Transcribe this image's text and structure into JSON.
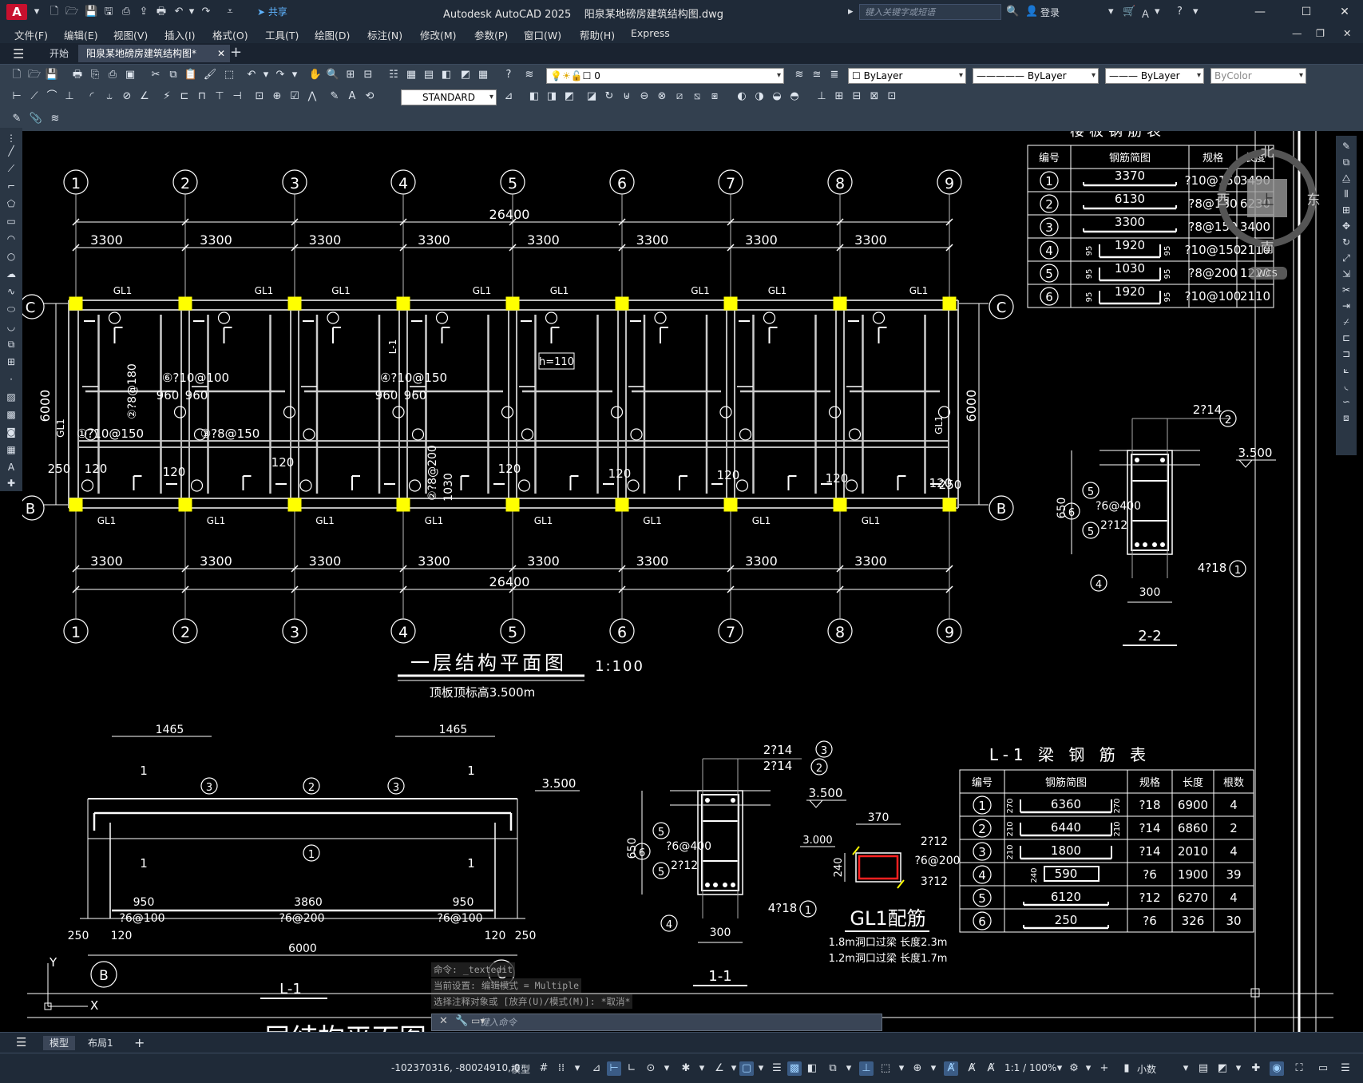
{
  "app": {
    "title": "Autodesk AutoCAD 2025",
    "file": "阳泉某地磅房建筑结构图.dwg",
    "logo": "A",
    "share": "共享",
    "search_placeholder": "键入关键字或短语",
    "login": "登录"
  },
  "menu": [
    "文件(F)",
    "编辑(E)",
    "视图(V)",
    "插入(I)",
    "格式(O)",
    "工具(T)",
    "绘图(D)",
    "标注(N)",
    "修改(M)",
    "参数(P)",
    "窗口(W)",
    "帮助(H)",
    "Express"
  ],
  "tabs": {
    "start": "开始",
    "doc": "阳泉某地磅房建筑结构图*"
  },
  "props": {
    "layer": "0",
    "color": "ByLayer",
    "linetype": "ByLayer",
    "lineweight": "ByLayer",
    "plotstyle": "ByColor",
    "textstyle": "STANDARD"
  },
  "layouts": {
    "model": "模型",
    "layout1": "布局1"
  },
  "status": {
    "coords": "-102370316, -80024910, 0",
    "model": "模型",
    "scale": "1:1 / 100%",
    "units": "小数"
  },
  "command": {
    "line1": "命令: _textedit",
    "line2": "当前设置: 编辑模式 = Multiple",
    "line3": "选择注释对象或 [放弃(U)/模式(M)]: *取消*",
    "placeholder": "键入命令"
  },
  "viewcube": {
    "n": "北",
    "w": "西",
    "e": "东",
    "s": "南",
    "top": "上",
    "wcs": "WCS"
  },
  "drawing": {
    "plan_title": "一层结构平面图",
    "plan_scale": "1:100",
    "plan_note": "顶板顶标高3.500m",
    "axes": [
      "1",
      "2",
      "3",
      "4",
      "5",
      "6",
      "7",
      "8",
      "9"
    ],
    "total_dim": "26400",
    "span_dim": "3300",
    "depth_dim": "6000",
    "beam_label": "GL1",
    "row_c": "C",
    "row_b": "B",
    "h_label": "h=110",
    "l1_label": "L-1",
    "plan_texts": [
      "⑥?10@100",
      "④?10@150",
      "①?10@150",
      "③?8@150",
      "②?8@180",
      "②?8@200",
      "960",
      "120",
      "250",
      "1030"
    ],
    "slab_table": {
      "title": "楼板钢筋表",
      "headers": [
        "编号",
        "钢筋简图",
        "规格",
        "长度"
      ],
      "rows": [
        [
          "1",
          "3370",
          "?10@150",
          "3490"
        ],
        [
          "2",
          "6130",
          "?8@180",
          "6230"
        ],
        [
          "3",
          "3300",
          "?8@150",
          "3400"
        ],
        [
          "4",
          "1920",
          "?10@150",
          "2110"
        ],
        [
          "5",
          "1030",
          "?8@200",
          "1220"
        ],
        [
          "6",
          "1920",
          "?10@100",
          "2110"
        ]
      ],
      "hook": "95"
    },
    "beam_table": {
      "title": "L-1 梁 钢 筋 表",
      "headers": [
        "编号",
        "钢筋简图",
        "规格",
        "长度",
        "根数"
      ],
      "rows": [
        [
          "1",
          "6360",
          "?18",
          "6900",
          "4"
        ],
        [
          "2",
          "6440",
          "?14",
          "6860",
          "2"
        ],
        [
          "3",
          "1800",
          "?14",
          "2010",
          "4"
        ],
        [
          "4",
          "590",
          "?6",
          "1900",
          "39"
        ],
        [
          "5",
          "6120",
          "?12",
          "6270",
          "4"
        ],
        [
          "6",
          "250",
          "?6",
          "326",
          "30"
        ]
      ],
      "hooks": [
        "270",
        "210",
        "240"
      ]
    },
    "sec22": {
      "title": "2-2",
      "h": "650",
      "w": "300",
      "top": "2?14",
      "stirrup": "?6@400",
      "mid": "2?12",
      "bot": "4?18",
      "elev": "3.500"
    },
    "sec11": {
      "title": "1-1",
      "h": "650",
      "w": "300",
      "top1": "2?14",
      "top2": "2?14",
      "stirrup": "?6@400",
      "mid": "2?12",
      "bot": "4?18",
      "elev": "3.500"
    },
    "gl1": {
      "title": "GL1配筋",
      "w": "370",
      "h": "240",
      "elev": "3.000",
      "top": "2?12",
      "stirrup": "?6@200",
      "bot": "3?12",
      "note1": "1.8m洞口过梁  长度2.3m",
      "note2": "1.2m洞口过梁  长度1.7m"
    },
    "l1": {
      "title": "L-1",
      "dim_left": "1465",
      "dim_right": "1465",
      "seg1": "950",
      "seg2": "3860",
      "seg3": "950",
      "st1": "?6@100",
      "st2": "?6@200",
      "st3": "?6@100",
      "edge1": "250",
      "edge2": "120",
      "edge3": "120",
      "edge4": "250",
      "total": "6000",
      "elev": "3.500",
      "mark": "1"
    },
    "ucs": {
      "x": "X",
      "y": "Y"
    }
  }
}
